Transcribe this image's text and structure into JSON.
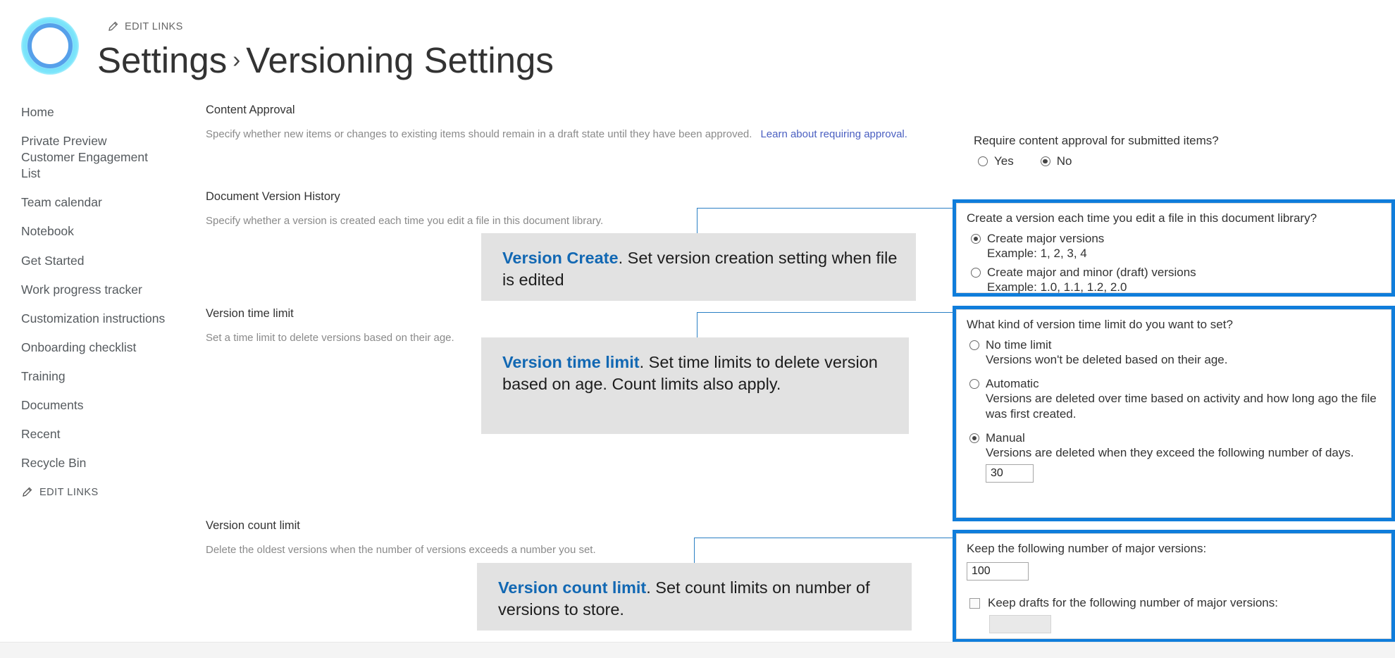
{
  "header": {
    "edit_links_label": "EDIT LINKS",
    "title_part1": "Settings",
    "title_separator": "›",
    "title_part2": "Versioning Settings",
    "logo_name": "site-logo-ring"
  },
  "sidebar": {
    "items": [
      {
        "label": "Home"
      },
      {
        "label": "Private Preview Customer Engagement List"
      },
      {
        "label": "Team calendar"
      },
      {
        "label": "Notebook"
      },
      {
        "label": "Get Started"
      },
      {
        "label": "Work progress tracker"
      },
      {
        "label": "Customization instructions"
      },
      {
        "label": "Onboarding checklist"
      },
      {
        "label": "Training"
      },
      {
        "label": "Documents"
      },
      {
        "label": "Recent"
      },
      {
        "label": "Recycle Bin"
      }
    ],
    "edit_links_label": "EDIT LINKS"
  },
  "sections": {
    "content_approval": {
      "title": "Content Approval",
      "description": "Specify whether new items or changes to existing items should remain in a draft state until they have been approved.",
      "link": "Learn about requiring approval.",
      "question": "Require content approval for submitted items?",
      "options": [
        {
          "label": "Yes",
          "selected": false
        },
        {
          "label": "No",
          "selected": true
        }
      ]
    },
    "document_version_history": {
      "title": "Document Version History",
      "description": "Specify whether a version is created each time you edit a file in this document library.",
      "question": "Create a version each time you edit a file in this document library?",
      "options": [
        {
          "label": "Create major versions",
          "example": "Example: 1, 2, 3, 4",
          "selected": true
        },
        {
          "label": "Create major and minor (draft) versions",
          "example": "Example: 1.0, 1.1, 1.2, 2.0",
          "selected": false
        }
      ]
    },
    "version_time_limit": {
      "title": "Version time limit",
      "description": "Set a time limit to delete versions based on their age.",
      "question": "What kind of version time limit do you want to set?",
      "options": [
        {
          "label": "No time limit",
          "sub": "Versions won't be deleted based on their age.",
          "selected": false
        },
        {
          "label": "Automatic",
          "sub": "Versions are deleted over time based on activity and how long ago the file was first created.",
          "selected": false
        },
        {
          "label": "Manual",
          "sub": "Versions are deleted when they exceed the following number of days.",
          "selected": true,
          "input_value": "30"
        }
      ]
    },
    "version_count_limit": {
      "title": "Version count limit",
      "description": "Delete the oldest versions when the number of versions exceeds a number you set.",
      "major_versions_label": "Keep the following number of major versions:",
      "major_versions_value": "100",
      "keep_drafts_label": "Keep drafts for the following number of major versions:",
      "keep_drafts_checked": false,
      "keep_drafts_value": ""
    }
  },
  "callouts": [
    {
      "keyword": "Version Create",
      "body": ". Set version creation setting when file is edited"
    },
    {
      "keyword": "Version time limit",
      "body": ". Set time limits to delete version based on age.  Count limits also apply."
    },
    {
      "keyword": "Version count limit",
      "body": ". Set count limits on number of versions to store."
    }
  ],
  "colors": {
    "highlight_border": "#0f7ddb",
    "callout_keyword": "#1268b3",
    "callout_bg": "#e2e2e2",
    "link": "#4a5fc1"
  }
}
